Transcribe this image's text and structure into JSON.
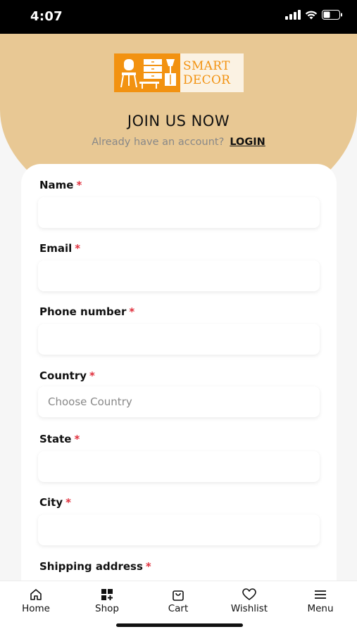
{
  "status_bar": {
    "time": "4:07"
  },
  "logo": {
    "line1": "SMART",
    "line2": "DECOR"
  },
  "header": {
    "title": "JOIN US NOW",
    "subtitle": "Already have an account?",
    "login_link": "LOGIN"
  },
  "form": {
    "required_mark": "*",
    "name_label": "Name",
    "email_label": "Email",
    "phone_label": "Phone number",
    "country_label": "Country",
    "country_placeholder": "Choose Country",
    "state_label": "State",
    "city_label": "City",
    "shipping_label": "Shipping address"
  },
  "nav": {
    "home": "Home",
    "shop": "Shop",
    "cart": "Cart",
    "wishlist": "Wishlist",
    "menu": "Menu"
  },
  "colors": {
    "accent": "#f29211",
    "hero_bg": "#e8c894",
    "required": "#e0303d"
  }
}
